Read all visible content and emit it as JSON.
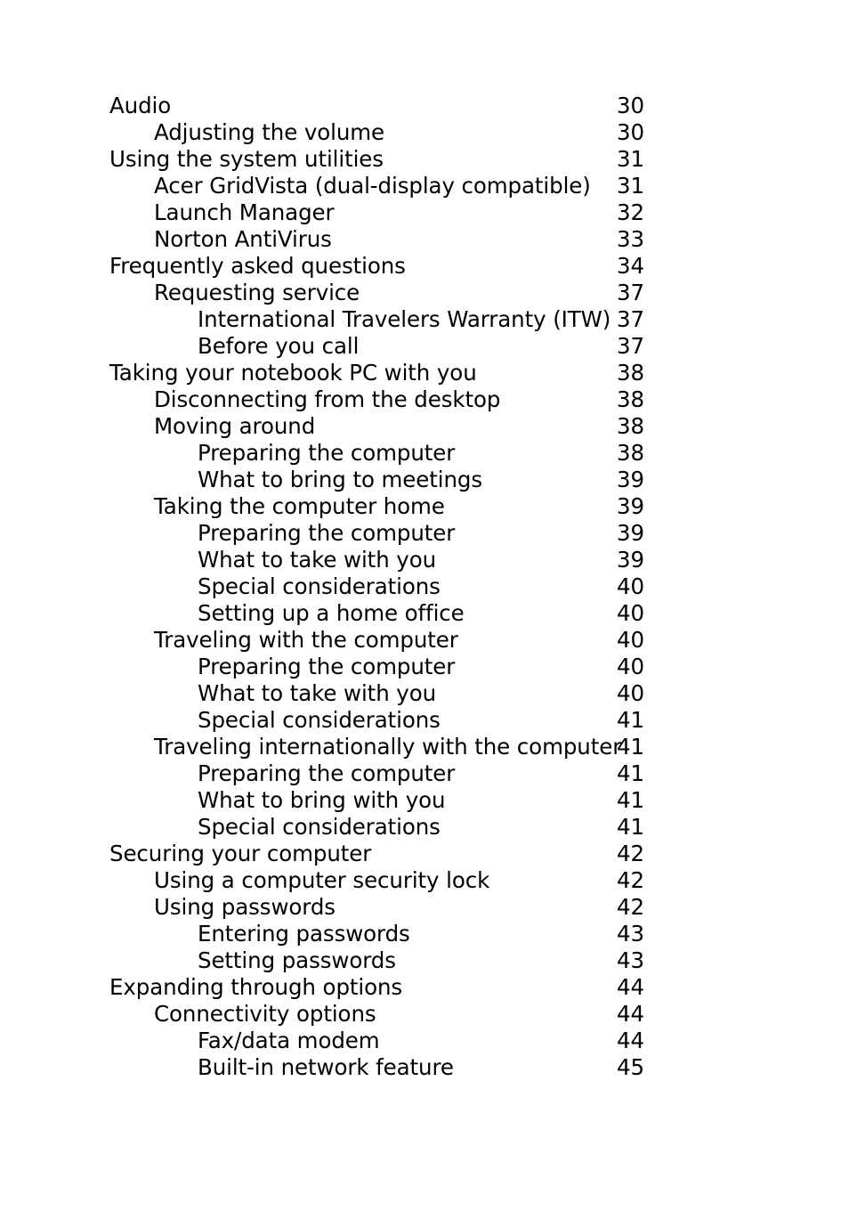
{
  "document": {
    "type": "table-of-contents",
    "page_background": "#ffffff",
    "text_color": "#000000"
  },
  "toc": {
    "entries": [
      {
        "title": "Audio",
        "page": "30",
        "level": 0
      },
      {
        "title": "Adjusting the volume",
        "page": "30",
        "level": 1
      },
      {
        "title": "Using the system utilities",
        "page": "31",
        "level": 0
      },
      {
        "title": "Acer GridVista (dual-display compatible)",
        "page": "31",
        "level": 1
      },
      {
        "title": "Launch Manager",
        "page": "32",
        "level": 1
      },
      {
        "title": "Norton AntiVirus",
        "page": "33",
        "level": 1
      },
      {
        "title": "Frequently asked questions",
        "page": "34",
        "level": 0
      },
      {
        "title": "Requesting service",
        "page": "37",
        "level": 1
      },
      {
        "title": "International Travelers Warranty (ITW)",
        "page": "37",
        "level": 2
      },
      {
        "title": "Before you call",
        "page": "37",
        "level": 2
      },
      {
        "title": "Taking your notebook PC with you",
        "page": "38",
        "level": 0
      },
      {
        "title": "Disconnecting from the desktop",
        "page": "38",
        "level": 1
      },
      {
        "title": "Moving around",
        "page": "38",
        "level": 1
      },
      {
        "title": "Preparing the computer",
        "page": "38",
        "level": 2
      },
      {
        "title": "What to bring to meetings",
        "page": "39",
        "level": 2
      },
      {
        "title": "Taking the computer home",
        "page": "39",
        "level": 1
      },
      {
        "title": "Preparing the computer",
        "page": "39",
        "level": 2
      },
      {
        "title": "What to take with you",
        "page": "39",
        "level": 2
      },
      {
        "title": "Special considerations",
        "page": "40",
        "level": 2
      },
      {
        "title": "Setting up a home office",
        "page": "40",
        "level": 2
      },
      {
        "title": "Traveling with the computer",
        "page": "40",
        "level": 1
      },
      {
        "title": "Preparing the computer",
        "page": "40",
        "level": 2
      },
      {
        "title": "What to take with you",
        "page": "40",
        "level": 2
      },
      {
        "title": "Special considerations",
        "page": "41",
        "level": 2
      },
      {
        "title": "Traveling internationally with the computer",
        "page": "41",
        "level": 1
      },
      {
        "title": "Preparing the computer",
        "page": "41",
        "level": 2
      },
      {
        "title": "What to bring with you",
        "page": "41",
        "level": 2
      },
      {
        "title": "Special considerations",
        "page": "41",
        "level": 2
      },
      {
        "title": "Securing your computer",
        "page": "42",
        "level": 0
      },
      {
        "title": "Using a computer security lock",
        "page": "42",
        "level": 1
      },
      {
        "title": "Using passwords",
        "page": "42",
        "level": 1
      },
      {
        "title": "Entering passwords",
        "page": "43",
        "level": 2
      },
      {
        "title": "Setting passwords",
        "page": "43",
        "level": 2
      },
      {
        "title": "Expanding through options",
        "page": "44",
        "level": 0
      },
      {
        "title": "Connectivity options",
        "page": "44",
        "level": 1
      },
      {
        "title": "Fax/data modem",
        "page": "44",
        "level": 2
      },
      {
        "title": "Built-in network feature",
        "page": "45",
        "level": 2
      }
    ]
  }
}
